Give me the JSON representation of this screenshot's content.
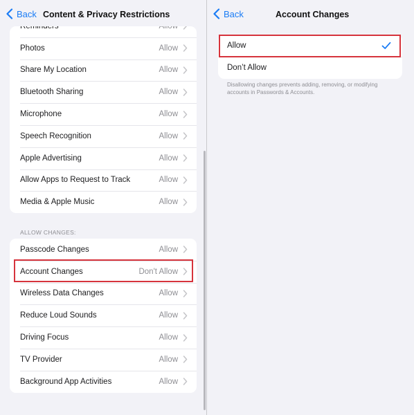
{
  "colors": {
    "accent": "#1a7cf5",
    "highlight": "#d6333c",
    "background": "#f2f2f7"
  },
  "left": {
    "back_label": "Back",
    "title": "Content & Privacy Restrictions",
    "group1": [
      {
        "label": "Reminders",
        "value": "Allow"
      },
      {
        "label": "Photos",
        "value": "Allow"
      },
      {
        "label": "Share My Location",
        "value": "Allow"
      },
      {
        "label": "Bluetooth Sharing",
        "value": "Allow"
      },
      {
        "label": "Microphone",
        "value": "Allow"
      },
      {
        "label": "Speech Recognition",
        "value": "Allow"
      },
      {
        "label": "Apple Advertising",
        "value": "Allow"
      },
      {
        "label": "Allow Apps to Request to Track",
        "value": "Allow"
      },
      {
        "label": "Media & Apple Music",
        "value": "Allow"
      }
    ],
    "section_header": "ALLOW CHANGES:",
    "group2": [
      {
        "label": "Passcode Changes",
        "value": "Allow"
      },
      {
        "label": "Account Changes",
        "value": "Don't Allow"
      },
      {
        "label": "Wireless Data Changes",
        "value": "Allow"
      },
      {
        "label": "Reduce Loud Sounds",
        "value": "Allow"
      },
      {
        "label": "Driving Focus",
        "value": "Allow"
      },
      {
        "label": "TV Provider",
        "value": "Allow"
      },
      {
        "label": "Background App Activities",
        "value": "Allow"
      }
    ]
  },
  "right": {
    "back_label": "Back",
    "title": "Account Changes",
    "options": [
      {
        "label": "Allow",
        "selected": true
      },
      {
        "label": "Don’t Allow",
        "selected": false
      }
    ],
    "footer": "Disallowing changes prevents adding, removing, or modifying accounts in Passwords & Accounts."
  }
}
